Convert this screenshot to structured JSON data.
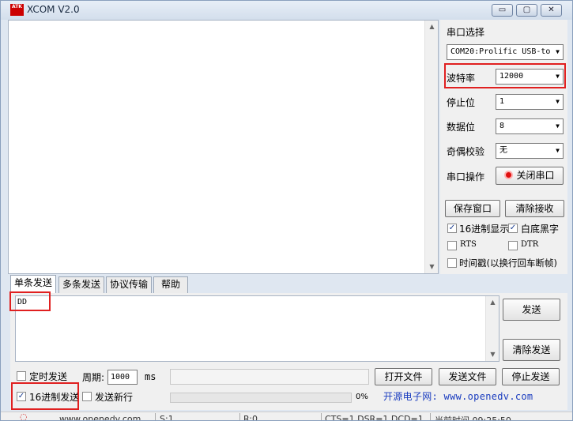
{
  "window": {
    "title": "XCOM V2.0",
    "logo_text": "ATK"
  },
  "window_buttons": {
    "minimize": "▭",
    "maximize": "▢",
    "close": "✕"
  },
  "serial": {
    "port_label": "串口选择",
    "port_value": "COM20:Prolific USB-to",
    "baud_label": "波特率",
    "baud_value": "12000",
    "stopbit_label": "停止位",
    "stopbit_value": "1",
    "databit_label": "数据位",
    "databit_value": "8",
    "parity_label": "奇偶校验",
    "parity_value": "无",
    "operation_label": "串口操作",
    "operation_button": "关闭串口"
  },
  "recv_controls": {
    "save_window": "保存窗口",
    "clear_recv": "清除接收",
    "hex_display": "16进制显示",
    "white_bg": "白底黑字",
    "rts": "RTS",
    "dtr": "DTR",
    "timestamp": "时间戳(以换行回车断帧)"
  },
  "tabs": [
    "单条发送",
    "多条发送",
    "协议传输",
    "帮助"
  ],
  "send": {
    "text": "DD",
    "send_button": "发送",
    "clear_send_button": "清除发送",
    "timed_send": "定时发送",
    "period_label": "周期:",
    "period_value": "1000",
    "period_unit": "ms",
    "open_file": "打开文件",
    "send_file": "发送文件",
    "stop_send": "停止发送",
    "hex_send": "16进制发送",
    "send_newline": "发送新行",
    "progress_text": "0%",
    "progress": 0,
    "link_text": "开源电子网: www.openedv.com"
  },
  "status_bar": {
    "site": "www.openedv.com",
    "s": "S:1",
    "r": "R:0",
    "lines": "CTS=1 DSR=1 DCD=1",
    "time": "当前时间 09:25:50"
  },
  "colors": {
    "highlight": "#e02020",
    "link": "#1a3cbf"
  }
}
